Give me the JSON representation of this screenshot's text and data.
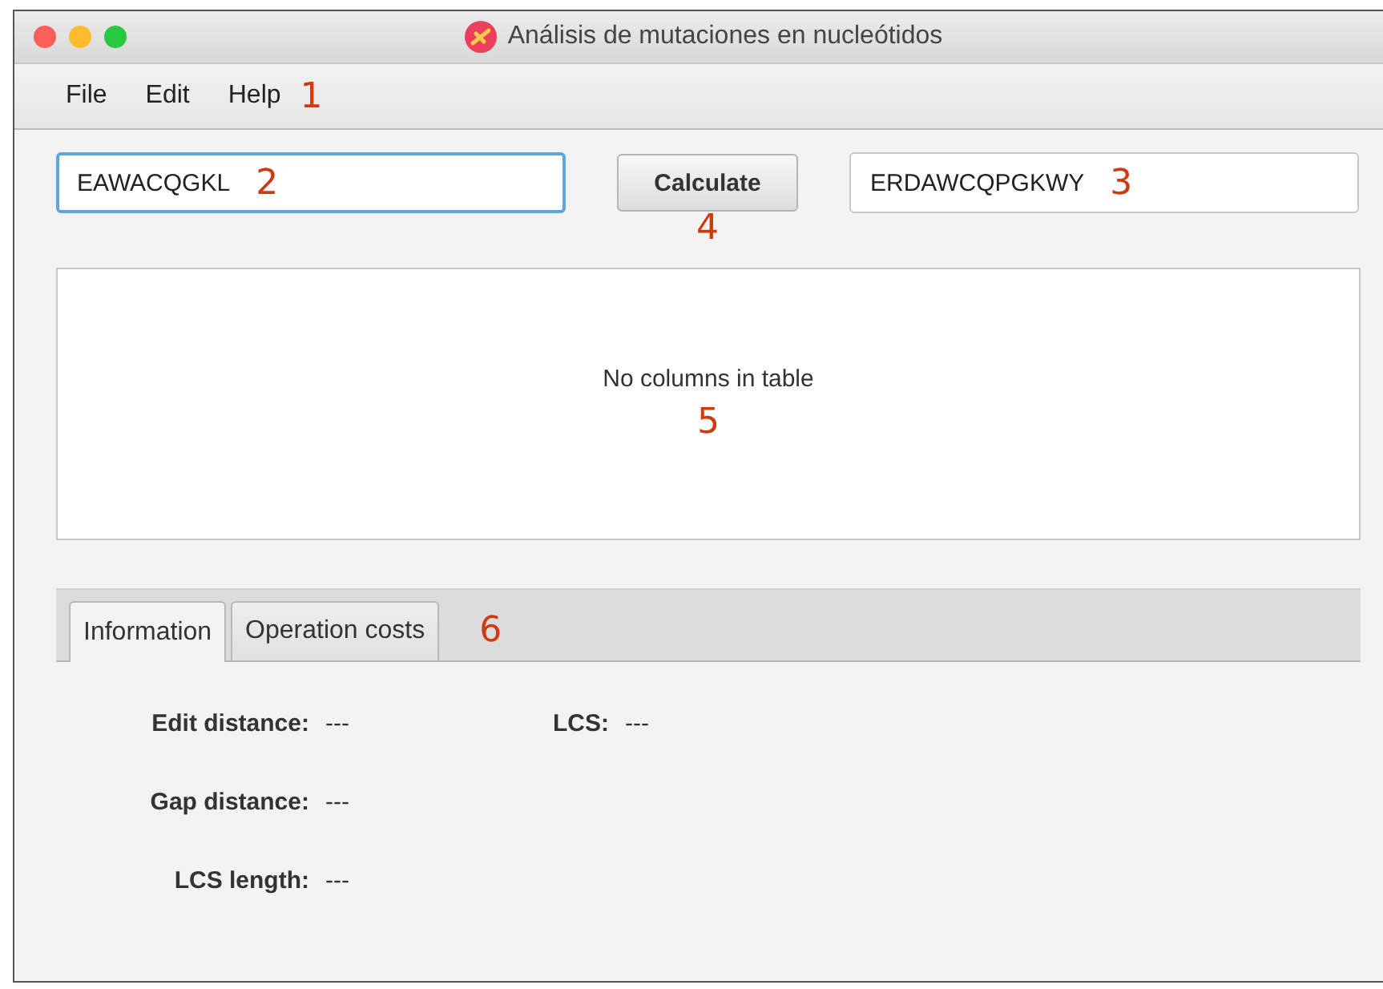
{
  "window": {
    "title": "Análisis de mutaciones en nucleótidos"
  },
  "menu": {
    "items": [
      "File",
      "Edit",
      "Help"
    ],
    "callout": "1"
  },
  "first_sequence": {
    "value": "EAWACQGKL",
    "focused": true,
    "callout": "2"
  },
  "calculate_button": {
    "label": "Calculate",
    "callout": "4"
  },
  "second_sequence": {
    "value": "ERDAWCQPGKWY",
    "focused": false,
    "callout": "3"
  },
  "table": {
    "empty_message": "No columns in table",
    "callout": "5"
  },
  "tabs": {
    "items": [
      {
        "label": "Information",
        "selected": true
      },
      {
        "label": "Operation costs",
        "selected": false
      }
    ],
    "callout": "6"
  },
  "information": {
    "rows": [
      [
        {
          "label": "Edit distance:",
          "value": "---"
        },
        {
          "label": "LCS:",
          "value": "---"
        }
      ],
      [
        {
          "label": "Gap distance:",
          "value": "---"
        }
      ],
      [
        {
          "label": "LCS length:",
          "value": "---"
        }
      ]
    ]
  }
}
